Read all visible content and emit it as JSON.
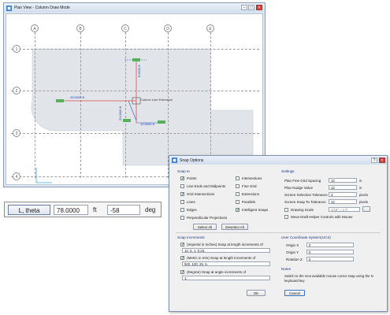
{
  "plan_window": {
    "title": "Plan View - Column Draw Mode",
    "column_labels": [
      "A",
      "B",
      "C",
      "D",
      "E"
    ],
    "row_labels": [
      "1",
      "2",
      "3",
      "4"
    ],
    "dimensions": {
      "d1": "43.0000 ft",
      "d2": "8.0000 ft",
      "d3": "20.0000 ft",
      "d4": "12.5000 ft"
    },
    "note": "Column Line Extension"
  },
  "command_bar": {
    "label": "L, theta",
    "length": "78.0000",
    "length_unit": "ft",
    "angle": "-58",
    "angle_unit": "deg"
  },
  "snap_dialog": {
    "title": "Snap Options",
    "snap_to": {
      "heading": "Snap to",
      "left": [
        {
          "label": "Points",
          "checked": true
        },
        {
          "label": "Line Ends and Midpoints",
          "checked": false
        },
        {
          "label": "Grid Intersections",
          "checked": true
        },
        {
          "label": "Lines",
          "checked": false
        },
        {
          "label": "Edges",
          "checked": false
        },
        {
          "label": "Perpendicular Projections",
          "checked": false
        }
      ],
      "right": [
        {
          "label": "Intersections",
          "checked": false
        },
        {
          "label": "Fine Grid",
          "checked": false
        },
        {
          "label": "Extensions",
          "checked": false
        },
        {
          "label": "Parallels",
          "checked": false
        },
        {
          "label": "Intelligent Snaps",
          "checked": true
        }
      ],
      "select_all": "Select All",
      "deselect_all": "Deselect All"
    },
    "settings": {
      "heading": "Settings",
      "rows": [
        {
          "label": "Plan Fine Grid Spacing",
          "value": "12",
          "unit": "in"
        },
        {
          "label": "Plan Nudge Value",
          "value": "12",
          "unit": "in"
        },
        {
          "label": "Screen Selection Tolerance",
          "value": "3",
          "unit": "pixels"
        },
        {
          "label": "Screen Snap To Tolerance",
          "value": "12",
          "unit": "pixels"
        }
      ],
      "drawing_scale_label": "Drawing Scale",
      "drawing_scale_value": "1/16\" = 1 ft",
      "move_draft_label": "Move Draft Helper Controls with Mouse"
    },
    "snap_increments": {
      "heading": "Snap Increments",
      "items": [
        {
          "label": "(Imperial in Inches) Snap at length increments of",
          "value": "12, 6, 1, 0.25,",
          "checked": true
        },
        {
          "label": "(Metric in mm) Snap at length increments of",
          "value": "500, 100, 25, 5,",
          "checked": true
        },
        {
          "label": "(Degree) Snap at angle increments of",
          "value": "1,",
          "checked": true
        }
      ]
    },
    "ucs": {
      "heading": "User Coordinate System(UCS)",
      "rows": [
        {
          "label": "Origin X",
          "value": "0"
        },
        {
          "label": "Origin Y",
          "value": "0"
        },
        {
          "label": "Rotation Z",
          "value": "0"
        }
      ]
    },
    "notes": {
      "heading": "Notes",
      "line1": "Switch to the next available mouse cursor snap using the N",
      "line2": "keyboard key"
    },
    "ok": "OK",
    "cancel": "Cancel"
  }
}
